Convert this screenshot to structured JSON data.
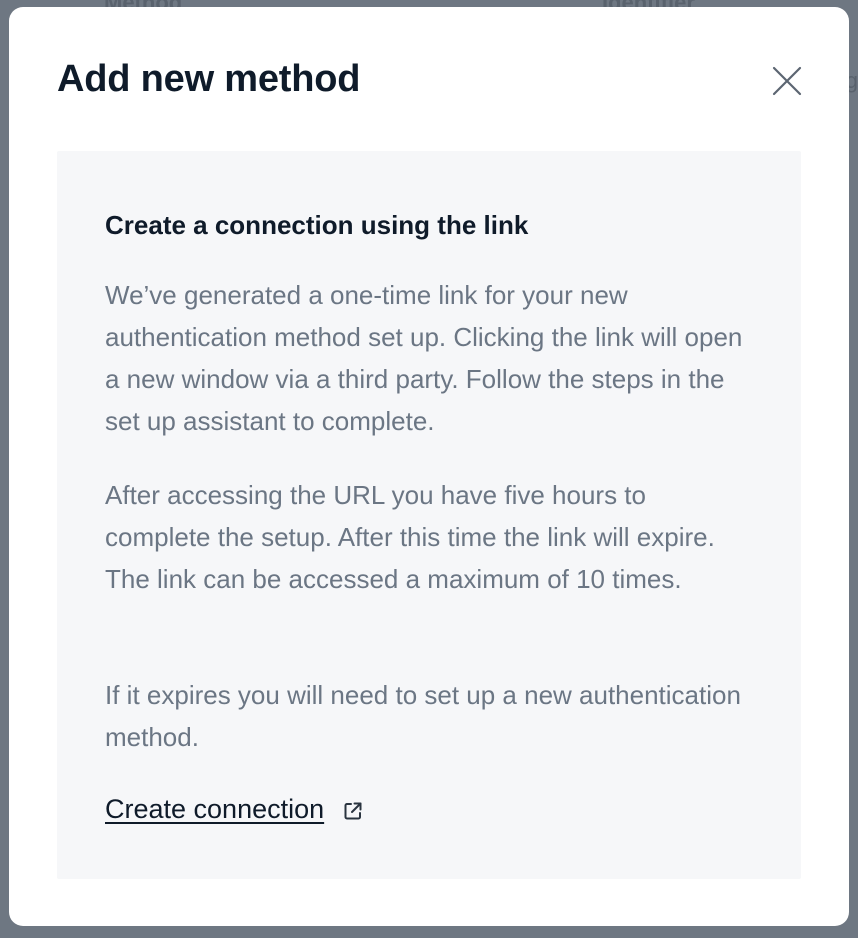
{
  "background": {
    "column_method": "Method",
    "column_identifier": "Identifier",
    "edge_text": "g"
  },
  "modal": {
    "title": "Add new method",
    "close_icon": "close-icon",
    "panel": {
      "heading": "Create a connection using the link",
      "paragraphs": [
        "We’ve generated a one-time link for your new authentication method set up. Clicking the link will open a new window via a third party. Follow the steps in the set up assistant to complete.",
        "After accessing the URL you have five hours to complete the setup. After this time the link will expire. The link can be accessed a maximum of 10 times.",
        "If it expires you will need to set up a new authentication method."
      ],
      "link_label": "Create connection",
      "link_icon": "external-link-icon"
    }
  },
  "colors": {
    "overlay": "#6e7782",
    "modal_bg": "#ffffff",
    "panel_bg": "#f6f7f9",
    "heading_text": "#0f1b2a",
    "body_text": "#6b7684"
  }
}
